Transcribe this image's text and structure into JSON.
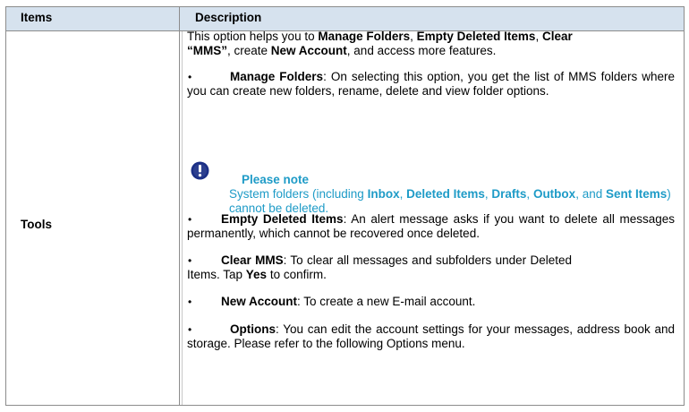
{
  "header": {
    "col1": "Items",
    "col2": "Description"
  },
  "row": {
    "item": "Tools",
    "intro": [
      "This option helps you to ",
      "Manage Folders",
      ", ",
      "Empty Deleted Items",
      ", ",
      "Clear",
      " ",
      "“MMS”",
      ", create ",
      "New Account",
      ", and access more features."
    ],
    "bullet_char": "•",
    "bullets": [
      {
        "term": "Manage Folders",
        "text": ": On selecting this option, you get the list of MMS folders where you can create new folders, rename, delete and view folder options."
      },
      {
        "term": "Empty Deleted Items",
        "text": ": An alert message asks if you want to delete all messages permanently, which cannot be recovered once deleted."
      },
      {
        "term": "Clear MMS",
        "text": ": To clear all messages and subfolders under Deleted Items. Tap ",
        "term2": "Yes",
        "text2": " to confirm."
      },
      {
        "term": "New Account",
        "text": ": To create a new E-mail account."
      },
      {
        "term": "Options",
        "text": ": You can edit the account settings for your messages, address book and storage. Please refer to the following Options menu."
      }
    ],
    "note": {
      "icon": "alert-icon",
      "title": "Please note",
      "parts": [
        "System folders (including ",
        "Inbox",
        ", ",
        "Deleted Items",
        ", ",
        "Drafts",
        ", ",
        "Outbox",
        ", and ",
        "Sent Items",
        ") cannot be deleted."
      ]
    }
  },
  "colors": {
    "header_bg": "#d6e2ee",
    "note_text": "#1e9bc7",
    "border": "#8c8c8c"
  }
}
